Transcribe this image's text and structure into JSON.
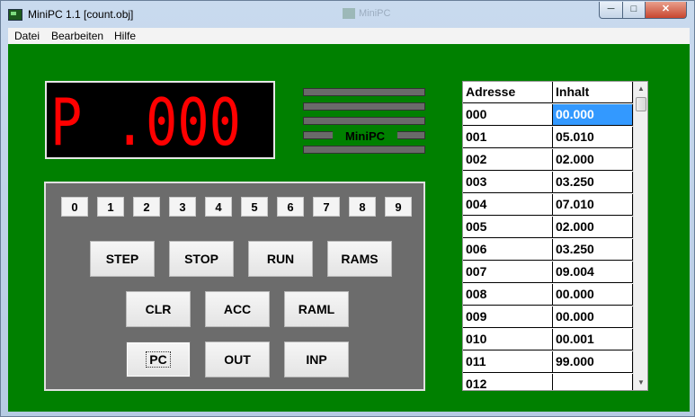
{
  "window": {
    "title": "MiniPC 1.1 [count.obj]",
    "ghost_title": "MiniPC"
  },
  "menu": [
    "Datei",
    "Bearbeiten",
    "Hilfe"
  ],
  "display": {
    "text": "P .000",
    "color": "#ff0000"
  },
  "brand_label": "MiniPC",
  "digits": [
    "0",
    "1",
    "2",
    "3",
    "4",
    "5",
    "6",
    "7",
    "8",
    "9"
  ],
  "keys": {
    "step": "STEP",
    "stop": "STOP",
    "run": "RUN",
    "rams": "RAMS",
    "clr": "CLR",
    "acc": "ACC",
    "raml": "RAML",
    "pc": "PC",
    "out": "OUT",
    "inp": "INP"
  },
  "memory_table": {
    "headers": [
      "Adresse",
      "Inhalt"
    ],
    "rows": [
      [
        "000",
        "00.000"
      ],
      [
        "001",
        "05.010"
      ],
      [
        "002",
        "02.000"
      ],
      [
        "003",
        "03.250"
      ],
      [
        "004",
        "07.010"
      ],
      [
        "005",
        "02.000"
      ],
      [
        "006",
        "03.250"
      ],
      [
        "007",
        "09.004"
      ],
      [
        "008",
        "00.000"
      ],
      [
        "009",
        "00.000"
      ],
      [
        "010",
        "00.001"
      ],
      [
        "011",
        "99.000"
      ],
      [
        "012",
        ""
      ]
    ],
    "selected_row": 0
  },
  "colors": {
    "background": "#008000",
    "keypad": "#6c6c6c",
    "selection": "#3399ff"
  }
}
